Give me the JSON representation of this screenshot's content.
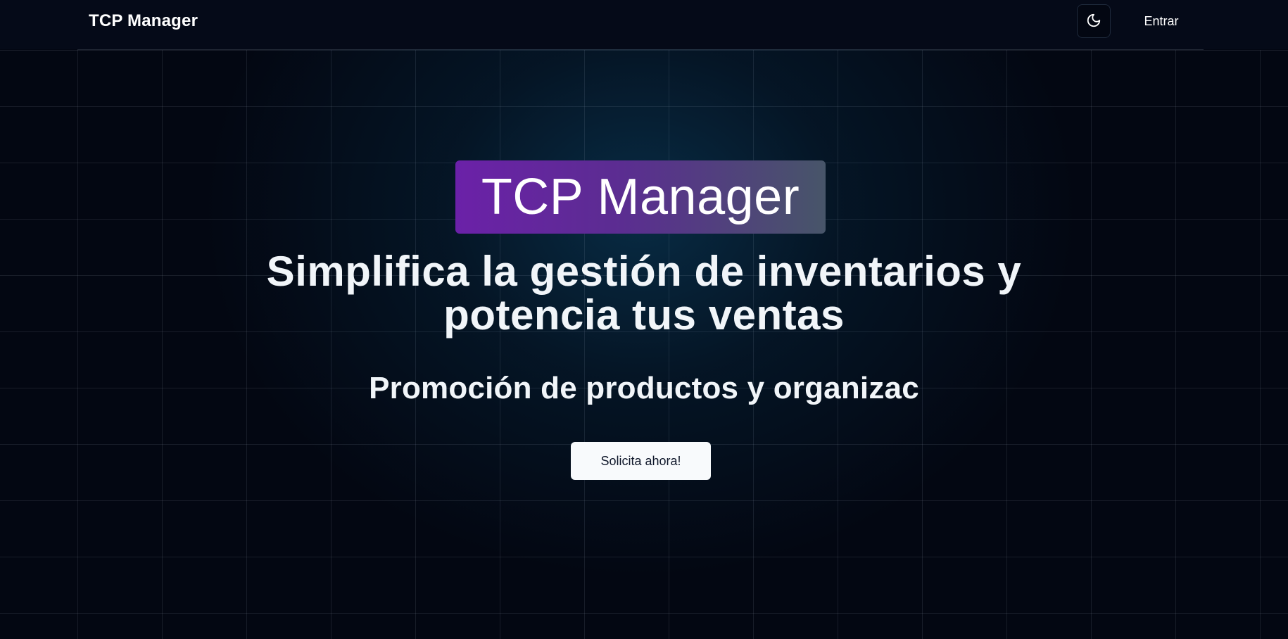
{
  "header": {
    "brand": "TCP Manager",
    "theme_toggle_icon": "moon-icon",
    "login_label": "Entrar"
  },
  "hero": {
    "badge_text": "TCP Manager",
    "title": "Simplifica la gestión de inventarios y potencia tus ventas",
    "subtitle": "Promoción de productos y organizac",
    "cta_label": "Solicita ahora!"
  },
  "colors": {
    "background": "#030712",
    "badge_gradient_start": "#6b21a8",
    "badge_gradient_end": "#475569",
    "cta_background": "#f8fafc",
    "glow": "#0c4a6e"
  }
}
